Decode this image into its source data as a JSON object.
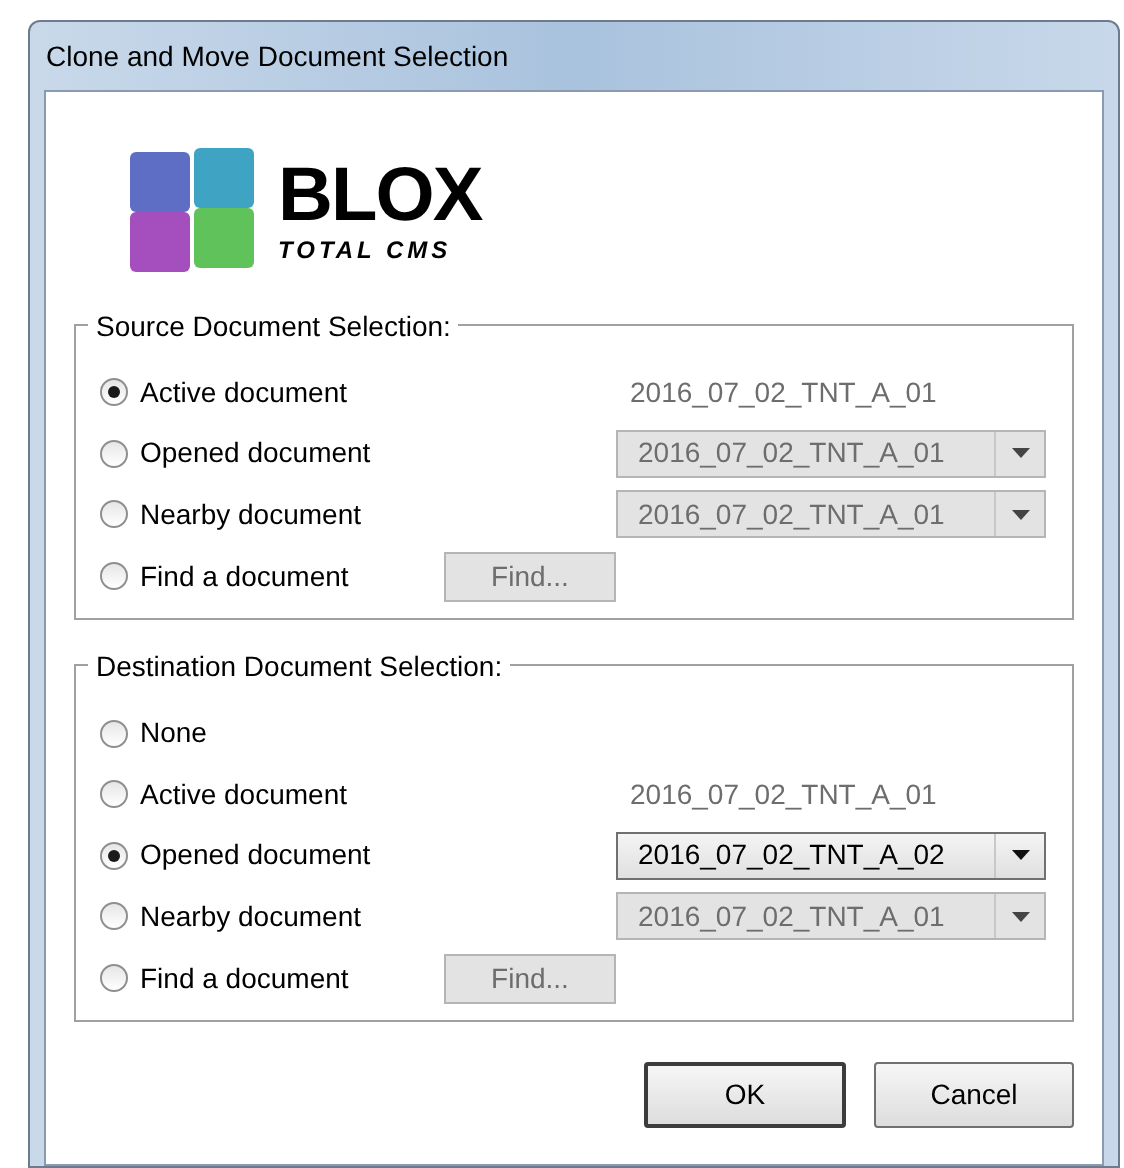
{
  "window": {
    "title": "Clone and Move Document Selection"
  },
  "logo": {
    "name": "BLOX",
    "tagline": "TOTAL CMS"
  },
  "groups": [
    {
      "title": "Source Document Selection:",
      "options": [
        {
          "label": "Active document",
          "selected": true,
          "kind": "text",
          "value": "2016_07_02_TNT_A_01"
        },
        {
          "label": "Opened document",
          "selected": false,
          "kind": "dropdown",
          "value": "2016_07_02_TNT_A_01",
          "disabled": true
        },
        {
          "label": "Nearby document",
          "selected": false,
          "kind": "dropdown",
          "value": "2016_07_02_TNT_A_01",
          "disabled": true
        },
        {
          "label": "Find a document",
          "selected": false,
          "kind": "find",
          "value": "Find...",
          "disabled": true
        }
      ]
    },
    {
      "title": "Destination Document Selection:",
      "options": [
        {
          "label": "None",
          "selected": false,
          "kind": "none"
        },
        {
          "label": "Active document",
          "selected": false,
          "kind": "text",
          "value": "2016_07_02_TNT_A_01"
        },
        {
          "label": "Opened document",
          "selected": true,
          "kind": "dropdown",
          "value": "2016_07_02_TNT_A_02",
          "disabled": false
        },
        {
          "label": "Nearby document",
          "selected": false,
          "kind": "dropdown",
          "value": "2016_07_02_TNT_A_01",
          "disabled": true
        },
        {
          "label": "Find a document",
          "selected": false,
          "kind": "find",
          "value": "Find...",
          "disabled": true
        }
      ]
    }
  ],
  "buttons": [
    {
      "label": "OK",
      "default": true
    },
    {
      "label": "Cancel",
      "default": false
    }
  ]
}
